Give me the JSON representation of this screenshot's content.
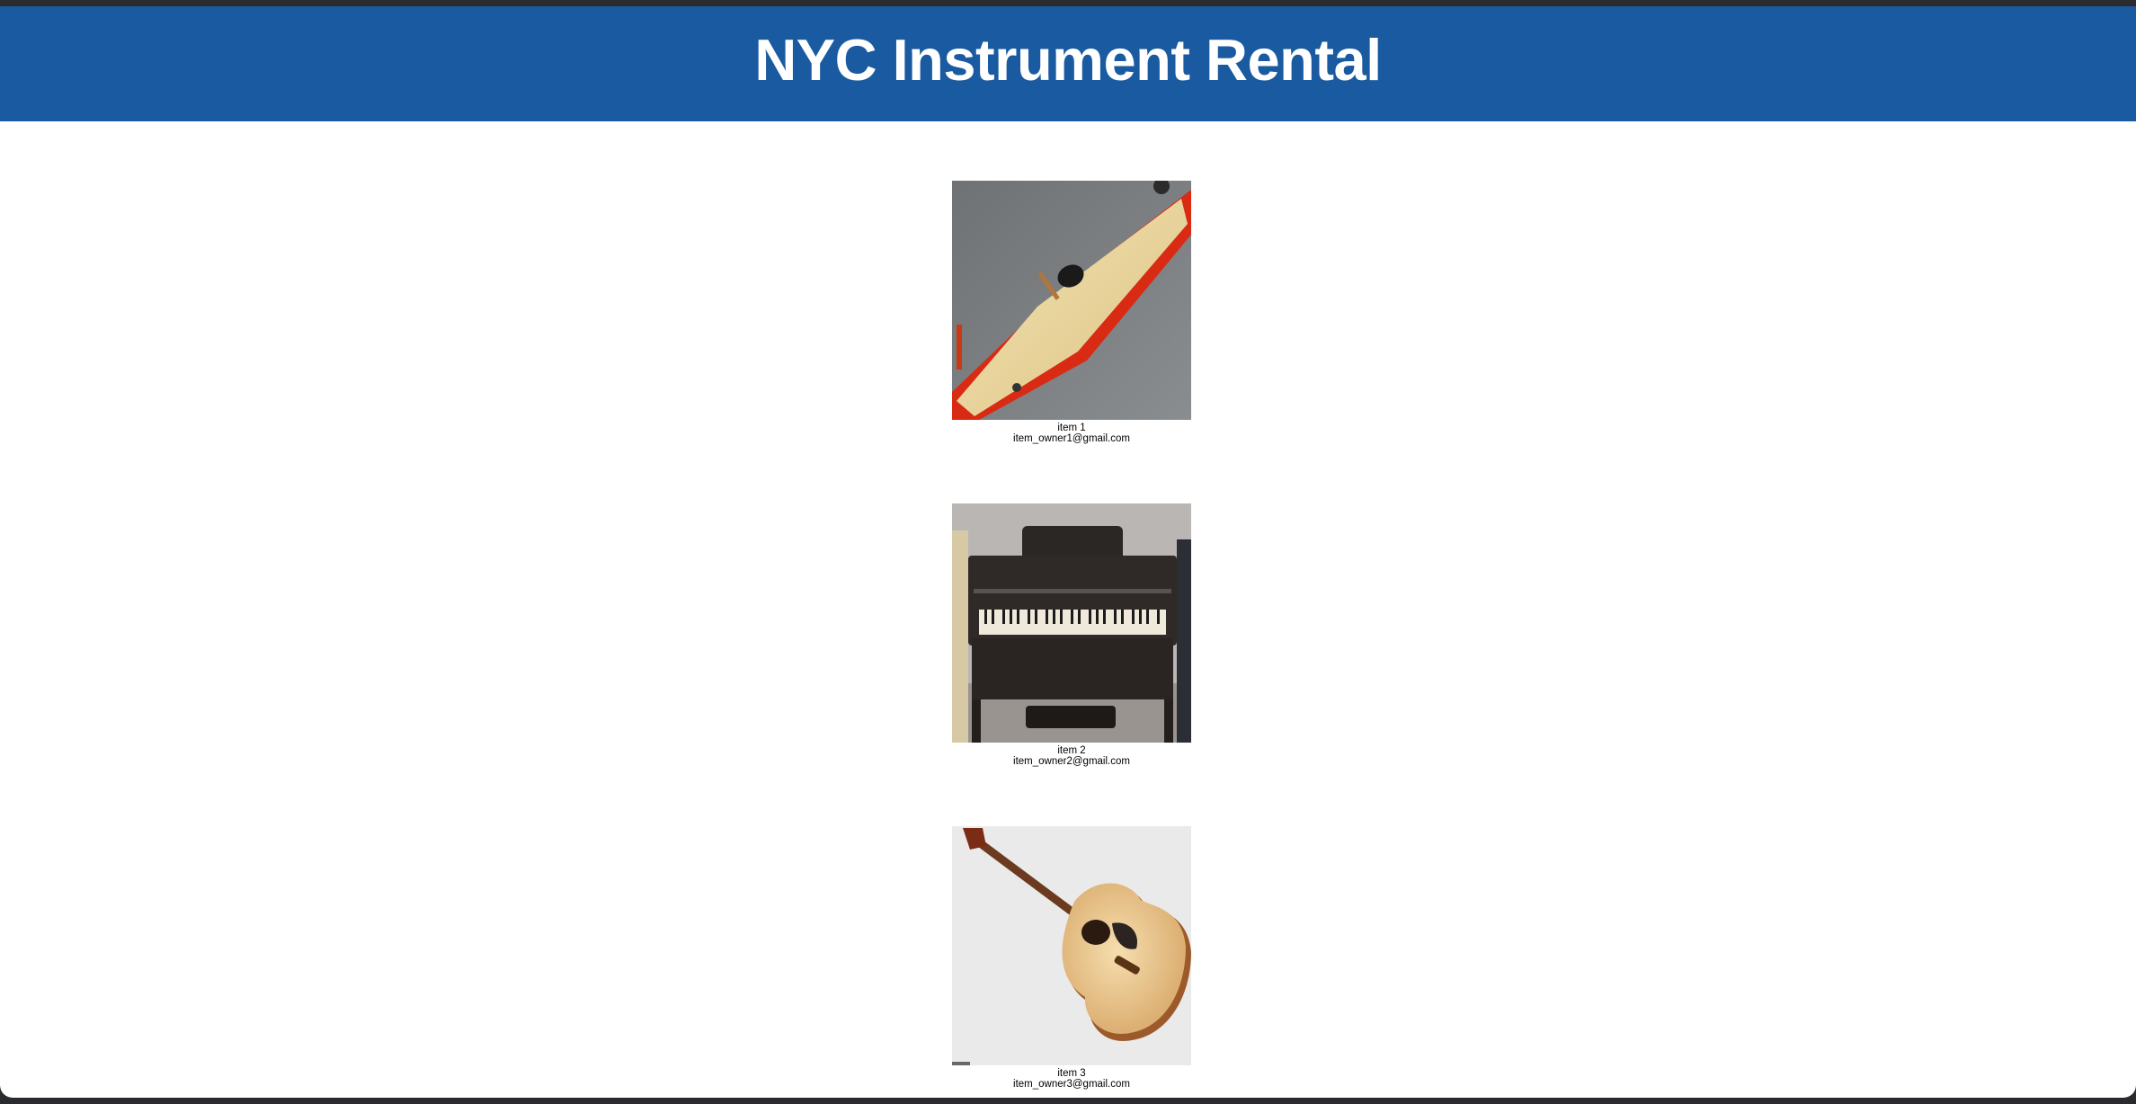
{
  "header": {
    "title": "NYC Instrument Rental"
  },
  "colors": {
    "header_bg": "#1a5aa0",
    "header_text": "#ffffff",
    "page_bg": "#ffffff"
  },
  "items": [
    {
      "name": "item 1",
      "owner_email": "item_owner1@gmail.com",
      "image": "strumstick-photo"
    },
    {
      "name": "item 2",
      "owner_email": "item_owner2@gmail.com",
      "image": "upright-piano-photo"
    },
    {
      "name": "item 3",
      "owner_email": "item_owner3@gmail.com",
      "image": "acoustic-guitar-photo"
    }
  ]
}
